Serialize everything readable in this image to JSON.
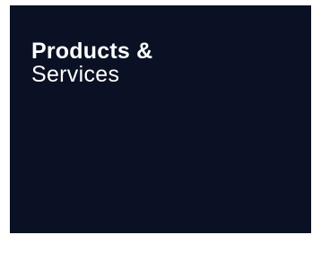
{
  "tile": {
    "title_line1": "Products &",
    "title_line2": "Services"
  },
  "colors": {
    "tile_background": "#0a1124",
    "tile_text": "#ffffff",
    "page_background": "#ffffff"
  }
}
